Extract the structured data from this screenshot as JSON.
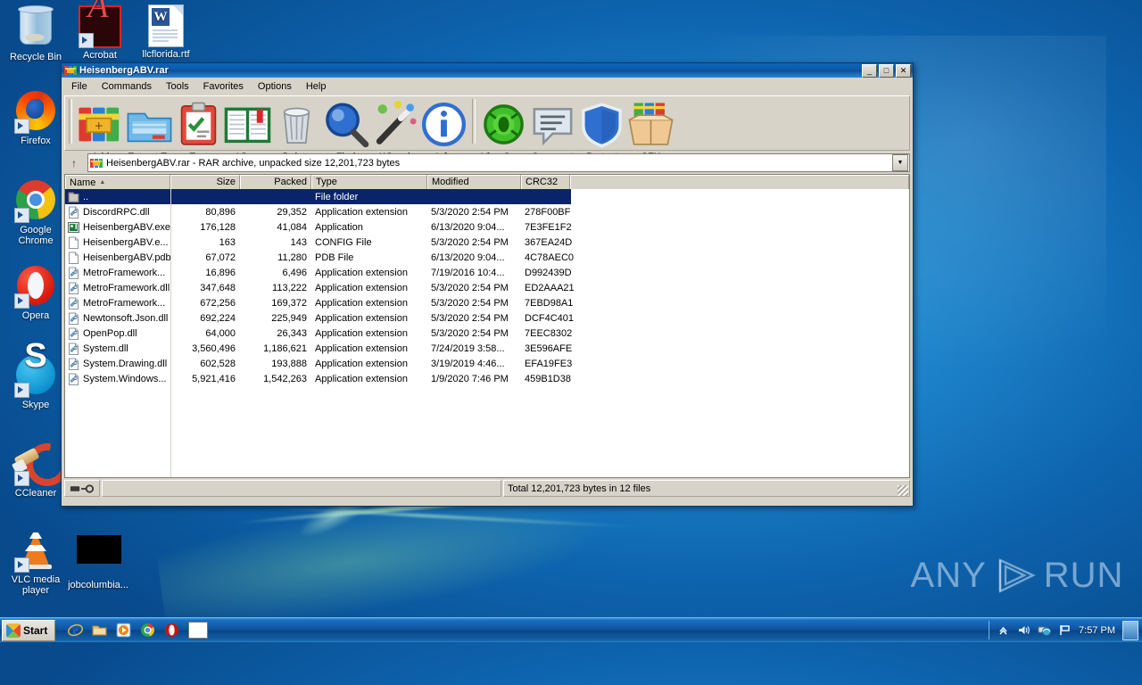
{
  "desktop": {
    "icons": [
      {
        "label": "Recycle Bin",
        "icon": "recycle-bin-icon",
        "shortcut": false
      },
      {
        "label": "Acrobat",
        "icon": "adobe-acrobat-icon",
        "shortcut": true
      },
      {
        "label": "llcflorida.rtf",
        "icon": "rtf-document-icon",
        "shortcut": false
      },
      {
        "label": "Firefox",
        "icon": "firefox-icon",
        "shortcut": true
      },
      {
        "label": "Google Chrome",
        "icon": "chrome-icon",
        "shortcut": true
      },
      {
        "label": "Opera",
        "icon": "opera-icon",
        "shortcut": true
      },
      {
        "label": "Skype",
        "icon": "skype-icon",
        "shortcut": true
      },
      {
        "label": "CCleaner",
        "icon": "ccleaner-icon",
        "shortcut": true
      },
      {
        "label": "VLC media player",
        "icon": "vlc-icon",
        "shortcut": true
      },
      {
        "label": "jobcolumbia...",
        "icon": "black-thumbnail-icon",
        "shortcut": false
      }
    ],
    "watermark": {
      "left": "ANY",
      "right": "RUN",
      "logo": "play-triangle-icon"
    }
  },
  "window": {
    "title": "HeisenbergABV.rar",
    "icon": "winrar-books-icon",
    "controls": {
      "minimize": "_",
      "maximize": "□",
      "close": "✕"
    },
    "menu": [
      "File",
      "Commands",
      "Tools",
      "Favorites",
      "Options",
      "Help"
    ],
    "toolbar": [
      {
        "label": "Add",
        "icon": "add-archive-icon"
      },
      {
        "label": "Extract To",
        "icon": "extract-folder-icon"
      },
      {
        "label": "Test",
        "icon": "test-clipboard-icon"
      },
      {
        "label": "View",
        "icon": "view-book-icon"
      },
      {
        "label": "Delete",
        "icon": "delete-trash-icon"
      },
      {
        "label": "Find",
        "icon": "find-magnifier-icon"
      },
      {
        "label": "Wizard",
        "icon": "wizard-wand-icon"
      },
      {
        "label": "Info",
        "icon": "info-circle-icon"
      },
      {
        "label": "VirusScan",
        "icon": "virusscan-icon"
      },
      {
        "label": "Comment",
        "icon": "comment-bubble-icon"
      },
      {
        "label": "Protect",
        "icon": "protect-shield-icon"
      },
      {
        "label": "SFX",
        "icon": "sfx-box-icon"
      }
    ],
    "path": {
      "up_label": "↑",
      "icon": "winrar-books-icon",
      "text": "HeisenbergABV.rar - RAR archive, unpacked size 12,201,723 bytes",
      "dropdown": "▼"
    },
    "columns": [
      {
        "label": "Name",
        "sort": "▲"
      },
      {
        "label": "Size"
      },
      {
        "label": "Packed"
      },
      {
        "label": "Type"
      },
      {
        "label": "Modified"
      },
      {
        "label": "CRC32"
      }
    ],
    "files": [
      {
        "name": "..",
        "size": "",
        "packed": "",
        "type": "File folder",
        "modified": "",
        "crc32": "",
        "icon": "folder-up-icon",
        "selected": true
      },
      {
        "name": "DiscordRPC.dll",
        "size": "80,896",
        "packed": "29,352",
        "type": "Application extension",
        "modified": "5/3/2020 2:54 PM",
        "crc32": "278F00BF",
        "icon": "dll-icon",
        "selected": false
      },
      {
        "name": "HeisenbergABV.exe",
        "size": "176,128",
        "packed": "41,084",
        "type": "Application",
        "modified": "6/13/2020 9:04...",
        "crc32": "7E3FE1F2",
        "icon": "exe-icon",
        "selected": false
      },
      {
        "name": "HeisenbergABV.e...",
        "size": "163",
        "packed": "143",
        "type": "CONFIG File",
        "modified": "5/3/2020 2:54 PM",
        "crc32": "367EA24D",
        "icon": "file-icon",
        "selected": false
      },
      {
        "name": "HeisenbergABV.pdb",
        "size": "67,072",
        "packed": "11,280",
        "type": "PDB File",
        "modified": "6/13/2020 9:04...",
        "crc32": "4C78AEC0",
        "icon": "file-icon",
        "selected": false
      },
      {
        "name": "MetroFramework...",
        "size": "16,896",
        "packed": "6,496",
        "type": "Application extension",
        "modified": "7/19/2016 10:4...",
        "crc32": "D992439D",
        "icon": "dll-icon",
        "selected": false
      },
      {
        "name": "MetroFramework.dll",
        "size": "347,648",
        "packed": "113,222",
        "type": "Application extension",
        "modified": "5/3/2020 2:54 PM",
        "crc32": "ED2AAA21",
        "icon": "dll-icon",
        "selected": false
      },
      {
        "name": "MetroFramework...",
        "size": "672,256",
        "packed": "169,372",
        "type": "Application extension",
        "modified": "5/3/2020 2:54 PM",
        "crc32": "7EBD98A1",
        "icon": "dll-icon",
        "selected": false
      },
      {
        "name": "Newtonsoft.Json.dll",
        "size": "692,224",
        "packed": "225,949",
        "type": "Application extension",
        "modified": "5/3/2020 2:54 PM",
        "crc32": "DCF4C401",
        "icon": "dll-icon",
        "selected": false
      },
      {
        "name": "OpenPop.dll",
        "size": "64,000",
        "packed": "26,343",
        "type": "Application extension",
        "modified": "5/3/2020 2:54 PM",
        "crc32": "7EEC8302",
        "icon": "dll-icon",
        "selected": false
      },
      {
        "name": "System.dll",
        "size": "3,560,496",
        "packed": "1,186,621",
        "type": "Application extension",
        "modified": "7/24/2019 3:58...",
        "crc32": "3E596AFE",
        "icon": "dll-icon",
        "selected": false
      },
      {
        "name": "System.Drawing.dll",
        "size": "602,528",
        "packed": "193,888",
        "type": "Application extension",
        "modified": "3/19/2019 4:46...",
        "crc32": "EFA19FE3",
        "icon": "dll-icon",
        "selected": false
      },
      {
        "name": "System.Windows...",
        "size": "5,921,416",
        "packed": "1,542,263",
        "type": "Application extension",
        "modified": "1/9/2020 7:46 PM",
        "crc32": "459B1D38",
        "icon": "dll-icon",
        "selected": false
      }
    ],
    "status": {
      "selection": "",
      "total": "Total 12,201,723 bytes in 12 files",
      "key_icon": "selection-key-icon"
    }
  },
  "taskbar": {
    "start_label": "Start",
    "quick_launch": [
      {
        "icon": "internet-explorer-icon"
      },
      {
        "icon": "windows-explorer-icon"
      },
      {
        "icon": "media-player-icon"
      },
      {
        "icon": "chrome-icon"
      },
      {
        "icon": "opera-icon"
      },
      {
        "icon": "white-window-icon"
      }
    ],
    "tray": [
      {
        "icon": "show-hidden-icons-chevron-icon"
      },
      {
        "icon": "volume-speaker-icon"
      },
      {
        "icon": "network-icon"
      },
      {
        "icon": "action-center-flag-icon"
      }
    ],
    "clock": "7:57 PM",
    "show_desktop": "show-desktop-button"
  },
  "colors": {
    "desktop_blue": "#1178c0",
    "title_blue": "#0e59a8",
    "selection_blue": "#0a246a",
    "chrome_gray": "#d7d3c8"
  }
}
